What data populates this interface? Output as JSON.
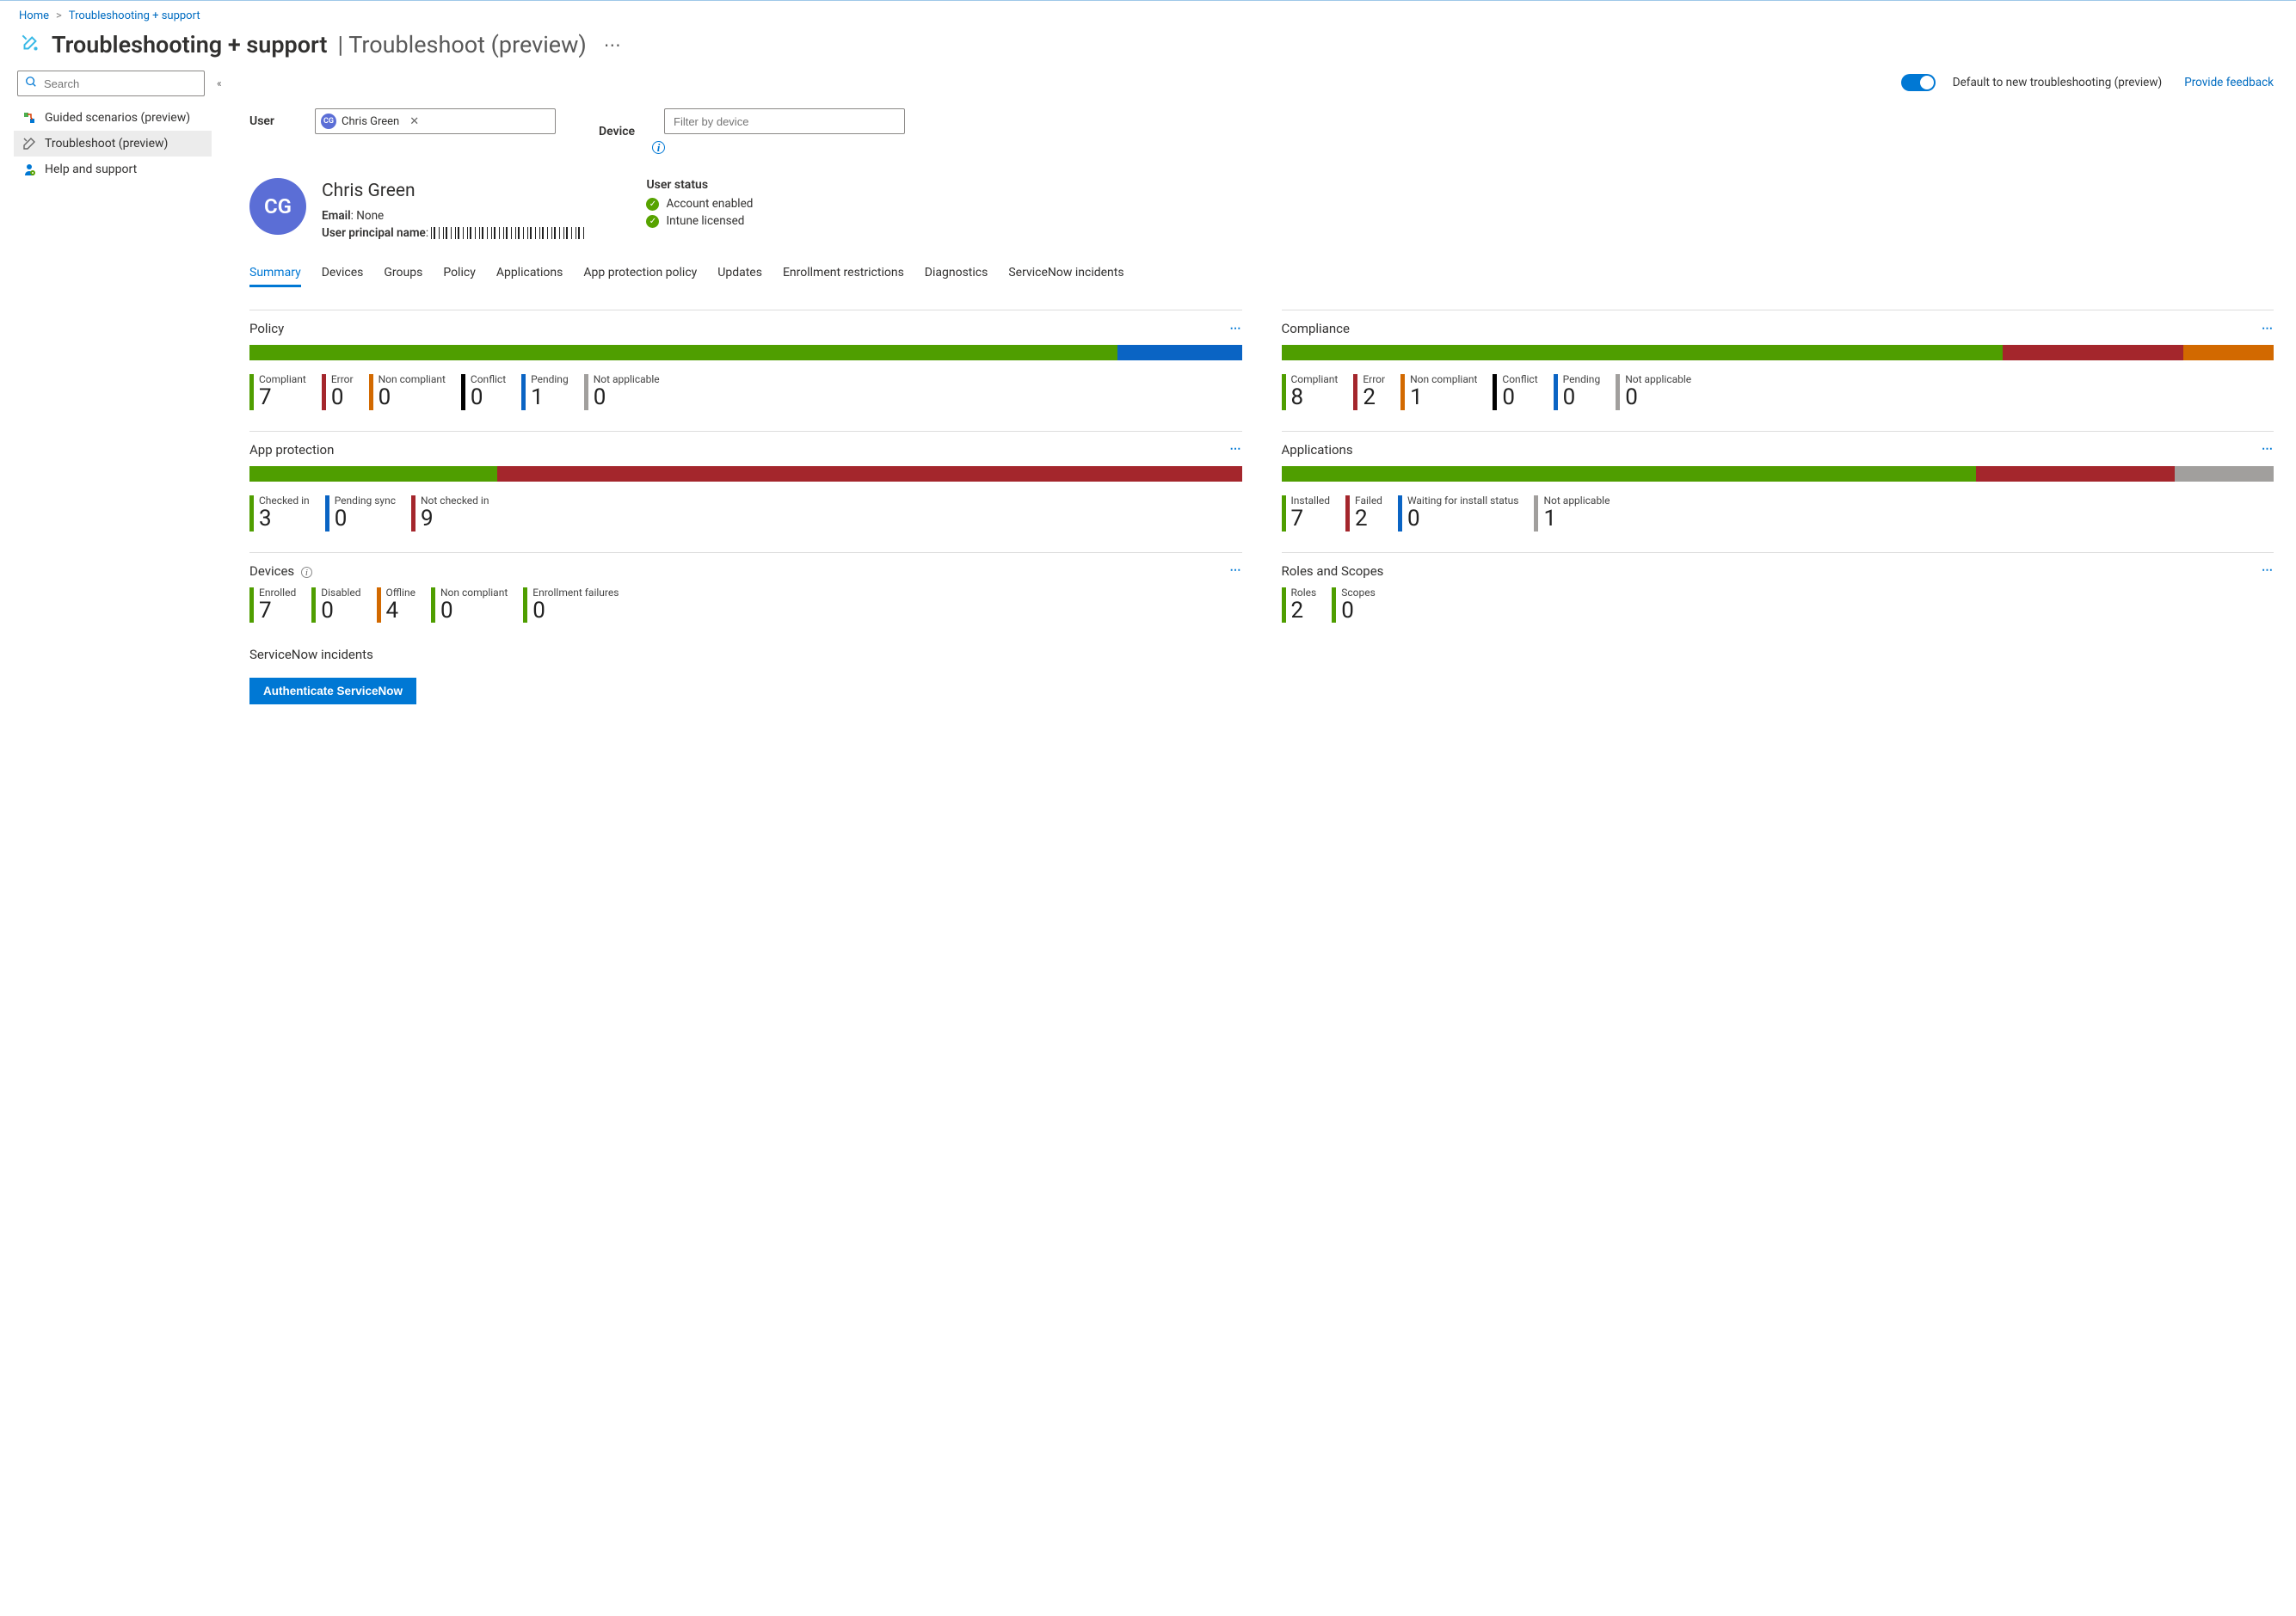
{
  "breadcrumb": {
    "home": "Home",
    "current": "Troubleshooting + support"
  },
  "title": {
    "main": "Troubleshooting + support",
    "sub": "Troubleshoot (preview)"
  },
  "sidebar": {
    "search_placeholder": "Search",
    "items": [
      {
        "label": "Guided scenarios (preview)"
      },
      {
        "label": "Troubleshoot (preview)"
      },
      {
        "label": "Help and support"
      }
    ]
  },
  "topbar": {
    "toggle_label": "Default to new troubleshooting (preview)",
    "feedback": "Provide feedback"
  },
  "filters": {
    "user_label": "User",
    "user_chip": "Chris Green",
    "user_initials": "CG",
    "device_label": "Device",
    "device_placeholder": "Filter by device"
  },
  "profile": {
    "initials": "CG",
    "name": "Chris Green",
    "email_label": "Email",
    "email_value": "None",
    "upn_label": "User principal name",
    "status_header": "User status",
    "status": [
      {
        "label": "Account enabled"
      },
      {
        "label": "Intune licensed"
      }
    ]
  },
  "tabs": [
    {
      "label": "Summary",
      "active": true
    },
    {
      "label": "Devices"
    },
    {
      "label": "Groups"
    },
    {
      "label": "Policy"
    },
    {
      "label": "Applications"
    },
    {
      "label": "App protection policy"
    },
    {
      "label": "Updates"
    },
    {
      "label": "Enrollment restrictions"
    },
    {
      "label": "Diagnostics"
    },
    {
      "label": "ServiceNow incidents"
    }
  ],
  "colors": {
    "green": "#4f9e00",
    "red": "#a4262c",
    "orange": "#d26900",
    "black": "#000000",
    "blue": "#0a64c4",
    "gray": "#a19f9d"
  },
  "cards": {
    "policy": {
      "title": "Policy",
      "bar": [
        {
          "color": "green",
          "weight": 7
        },
        {
          "color": "blue",
          "weight": 1
        }
      ],
      "metrics": [
        {
          "label": "Compliant",
          "value": "7",
          "color": "green"
        },
        {
          "label": "Error",
          "value": "0",
          "color": "red"
        },
        {
          "label": "Non compliant",
          "value": "0",
          "color": "orange"
        },
        {
          "label": "Conflict",
          "value": "0",
          "color": "black"
        },
        {
          "label": "Pending",
          "value": "1",
          "color": "blue"
        },
        {
          "label": "Not applicable",
          "value": "0",
          "color": "gray"
        }
      ]
    },
    "compliance": {
      "title": "Compliance",
      "bar": [
        {
          "color": "green",
          "weight": 8
        },
        {
          "color": "red",
          "weight": 2
        },
        {
          "color": "orange",
          "weight": 1
        }
      ],
      "metrics": [
        {
          "label": "Compliant",
          "value": "8",
          "color": "green"
        },
        {
          "label": "Error",
          "value": "2",
          "color": "red"
        },
        {
          "label": "Non compliant",
          "value": "1",
          "color": "orange"
        },
        {
          "label": "Conflict",
          "value": "0",
          "color": "black"
        },
        {
          "label": "Pending",
          "value": "0",
          "color": "blue"
        },
        {
          "label": "Not applicable",
          "value": "0",
          "color": "gray"
        }
      ]
    },
    "app_protection": {
      "title": "App protection",
      "bar": [
        {
          "color": "green",
          "weight": 3
        },
        {
          "color": "red",
          "weight": 9
        }
      ],
      "metrics": [
        {
          "label": "Checked in",
          "value": "3",
          "color": "green"
        },
        {
          "label": "Pending sync",
          "value": "0",
          "color": "blue"
        },
        {
          "label": "Not checked in",
          "value": "9",
          "color": "red"
        }
      ]
    },
    "applications": {
      "title": "Applications",
      "bar": [
        {
          "color": "green",
          "weight": 7
        },
        {
          "color": "red",
          "weight": 2
        },
        {
          "color": "gray",
          "weight": 1
        }
      ],
      "metrics": [
        {
          "label": "Installed",
          "value": "7",
          "color": "green"
        },
        {
          "label": "Failed",
          "value": "2",
          "color": "red"
        },
        {
          "label": "Waiting for install status",
          "value": "0",
          "color": "blue"
        },
        {
          "label": "Not applicable",
          "value": "1",
          "color": "gray"
        }
      ]
    },
    "devices": {
      "title": "Devices",
      "info": true,
      "metrics": [
        {
          "label": "Enrolled",
          "value": "7",
          "color": "green"
        },
        {
          "label": "Disabled",
          "value": "0",
          "color": "green"
        },
        {
          "label": "Offline",
          "value": "4",
          "color": "orange"
        },
        {
          "label": "Non compliant",
          "value": "0",
          "color": "green"
        },
        {
          "label": "Enrollment failures",
          "value": "0",
          "color": "green"
        }
      ]
    },
    "roles": {
      "title": "Roles and Scopes",
      "metrics": [
        {
          "label": "Roles",
          "value": "2",
          "color": "green"
        },
        {
          "label": "Scopes",
          "value": "0",
          "color": "green"
        }
      ]
    }
  },
  "servicenow": {
    "header": "ServiceNow incidents",
    "button": "Authenticate ServiceNow"
  }
}
